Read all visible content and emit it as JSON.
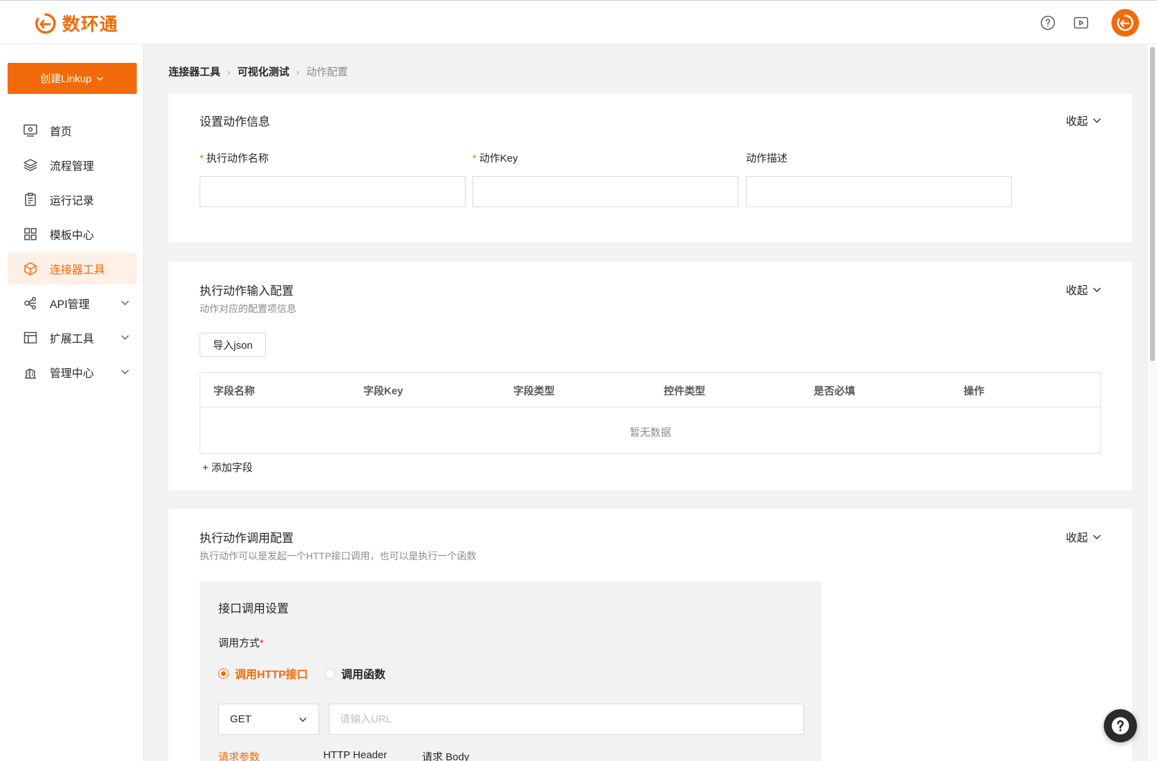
{
  "brand": {
    "name": "数环通",
    "accent": "#f36a0a"
  },
  "topbar": {
    "icons": [
      "help-circle-icon",
      "video-icon",
      "user-avatar-logo"
    ]
  },
  "sidebar": {
    "create_label": "创建Linkup",
    "items": [
      {
        "label": "首页",
        "icon": "monitor-icon"
      },
      {
        "label": "流程管理",
        "icon": "layers-icon"
      },
      {
        "label": "运行记录",
        "icon": "clipboard-icon"
      },
      {
        "label": "模板中心",
        "icon": "grid-icon"
      },
      {
        "label": "连接器工具",
        "icon": "cube-icon",
        "active": true
      },
      {
        "label": "API管理",
        "icon": "share-nodes-icon",
        "expandable": true
      },
      {
        "label": "扩展工具",
        "icon": "layout-icon",
        "expandable": true
      },
      {
        "label": "管理中心",
        "icon": "building-icon",
        "expandable": true
      }
    ]
  },
  "breadcrumb": {
    "items": [
      "连接器工具",
      "可视化测试"
    ],
    "current": "动作配置"
  },
  "section1": {
    "title": "设置动作信息",
    "collapse_label": "收起",
    "fields": [
      {
        "label": "执行动作名称",
        "required": true,
        "value": ""
      },
      {
        "label": "动作Key",
        "required": true,
        "value": ""
      },
      {
        "label": "动作描述",
        "required": false,
        "value": ""
      }
    ]
  },
  "section2": {
    "title": "执行动作输入配置",
    "subtitle": "动作对应的配置项信息",
    "collapse_label": "收起",
    "import_label": "导入json",
    "columns": [
      "字段名称",
      "字段Key",
      "字段类型",
      "控件类型",
      "是否必填",
      "操作"
    ],
    "empty_text": "暂无数据",
    "add_label": "+ 添加字段"
  },
  "section3": {
    "title": "执行动作调用配置",
    "subtitle": "执行动作可以是发起一个HTTP接口调用，也可以是执行一个函数",
    "collapse_label": "收起",
    "panel": {
      "title": "接口调用设置",
      "mode_label": "调用方式",
      "mode_required": "*",
      "options": [
        {
          "label": "调用HTTP接口",
          "checked": true
        },
        {
          "label": "调用函数",
          "checked": false
        }
      ],
      "method": "GET",
      "url_placeholder": "请输入URL",
      "tabs": [
        "请求参数",
        "HTTP Header",
        "请求 Body"
      ]
    }
  }
}
